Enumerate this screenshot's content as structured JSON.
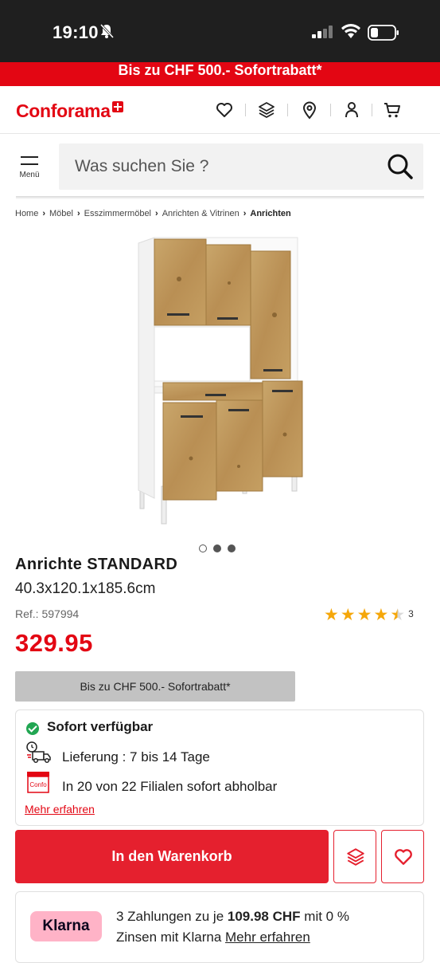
{
  "status_bar": {
    "time": "19:10"
  },
  "promo_banner": {
    "text": "Bis zu CHF 500.- Sofortrabatt*"
  },
  "header": {
    "logo": "Conforama",
    "icons": [
      "heart-icon",
      "layers-icon",
      "location-icon",
      "user-icon",
      "cart-icon"
    ]
  },
  "menu": {
    "label": "Menü"
  },
  "search": {
    "placeholder": "Was suchen Sie ?"
  },
  "breadcrumb": {
    "items": [
      "Home",
      "Möbel",
      "Esszimmermöbel",
      "Anrichten & Vitrinen"
    ],
    "current": "Anrichten"
  },
  "gallery": {
    "total": 3,
    "active_index": 0
  },
  "product": {
    "title": "Anrichte STANDARD",
    "dimensions": "40.3x120.1x185.6cm",
    "ref": "Ref.: 597994",
    "rating": 4.5,
    "rating_count": "3",
    "price": "329.95",
    "discount_badge": "Bis zu CHF 500.- Sofortrabatt*"
  },
  "availability": {
    "title": "Sofort verfügbar",
    "delivery": "Lieferung : 7 bis 14 Tage",
    "store_pickup": "In 20 von 22 Filialen sofort abholbar",
    "store_icon_text": "Confo",
    "more_link": "Mehr erfahren"
  },
  "actions": {
    "add_to_cart": "In den Warenkorb"
  },
  "klarna": {
    "logo": "Klarna",
    "text_prefix": "3 Zahlungen zu je",
    "amount": "109.98 CHF",
    "text_suffix": "mit 0 %",
    "text_line2": "Zinsen mit Klarna",
    "link": "Mehr erfahren"
  },
  "colors": {
    "brand_red": "#e30613",
    "star": "#f5a70a",
    "klarna_pink": "#ffb3c7"
  }
}
